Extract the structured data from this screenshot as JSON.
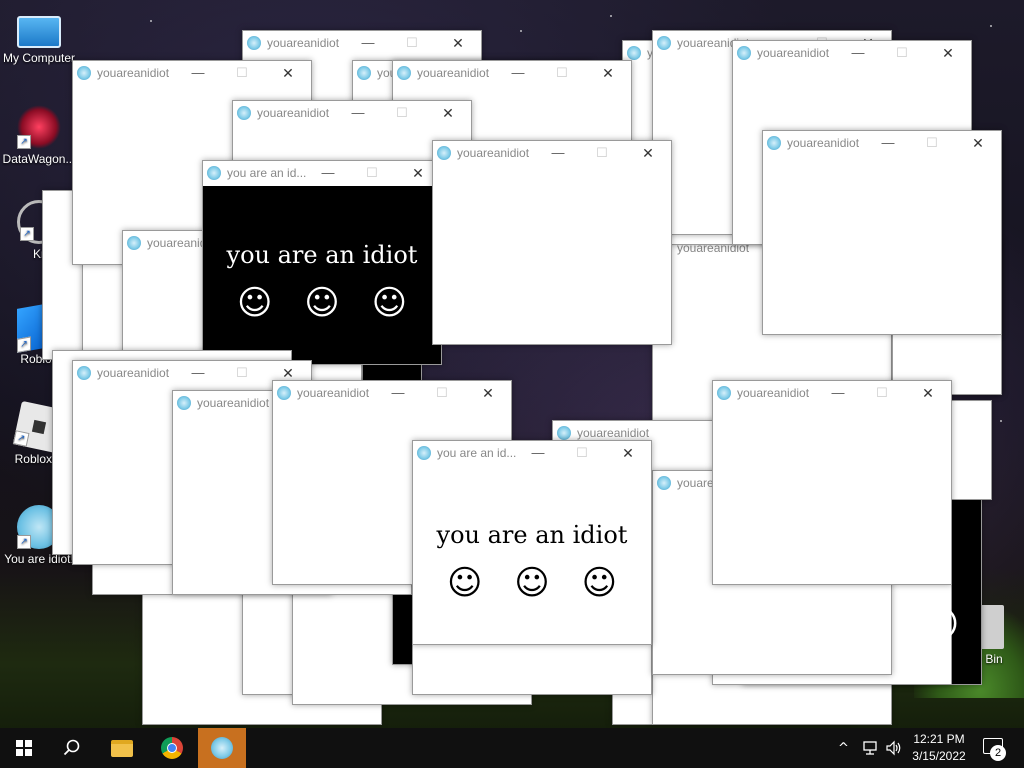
{
  "desktop_icons": [
    {
      "label": "My Computer",
      "icon": "computer-icon"
    },
    {
      "label": "DataWagon...",
      "icon": "datawagon-icon"
    },
    {
      "label": "Kr",
      "icon": "krita-icon"
    },
    {
      "label": "Roblox",
      "icon": "roblox-icon"
    },
    {
      "label": "Roblox P",
      "icon": "roblox-studio-icon"
    },
    {
      "label": "You are idiot!",
      "icon": "you-are-idiot-icon"
    },
    {
      "label": "e Bin",
      "icon": "recycle-bin-icon"
    }
  ],
  "window": {
    "title": "youareanidiot",
    "title_short": "you are an id...",
    "min_glyph": "—",
    "max_glyph": "☐",
    "close_glyph": "✕",
    "message": "you are an idiot",
    "smiley": "☺",
    "partial_title": "youare",
    "partial_title_2": "you"
  },
  "taskbar": {
    "start_icon": "windows-logo-icon",
    "search_icon": "search-icon",
    "pinned": [
      "file-explorer-icon",
      "chrome-icon",
      "you-are-idiot-app-icon"
    ],
    "time": "12:21 PM",
    "date": "3/15/2022",
    "notification_count": "2",
    "tray_chevron": "^",
    "colors": {
      "active_app": "#c8701f",
      "taskbar_bg": "#101010"
    }
  }
}
